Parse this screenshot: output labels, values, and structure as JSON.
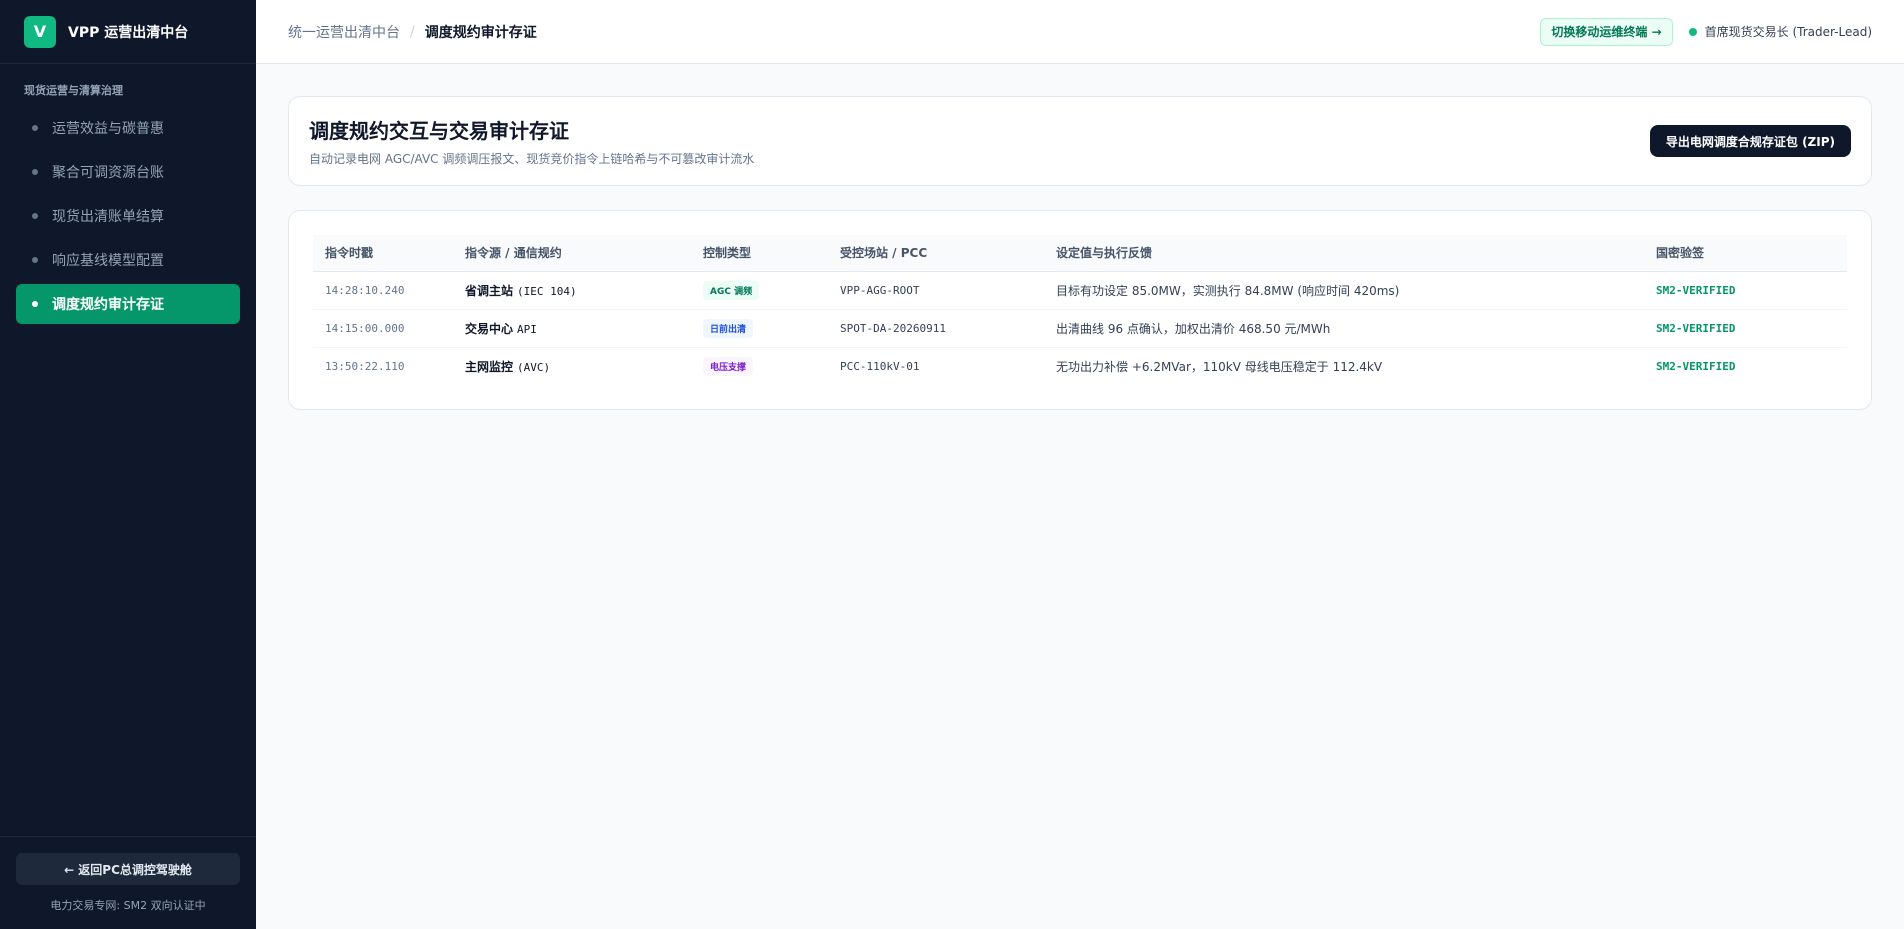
{
  "brand": {
    "logo_letter": "V",
    "name": "VPP 运营出清中台"
  },
  "sidebar": {
    "section_title": "现货运营与清算治理",
    "items": [
      {
        "label": "运营效益与碳普惠",
        "active": false
      },
      {
        "label": "聚合可调资源台账",
        "active": false
      },
      {
        "label": "现货出清账单结算",
        "active": false
      },
      {
        "label": "响应基线模型配置",
        "active": false
      },
      {
        "label": "调度规约审计存证",
        "active": true
      }
    ],
    "back_button": "← 返回PC总调控驾驶舱",
    "footer_note": "电力交易专网: SM2 双向认证中"
  },
  "topbar": {
    "breadcrumb_parent": "统一运营出清中台",
    "breadcrumb_separator": "/",
    "breadcrumb_current": "调度规约审计存证",
    "switch_button": "切换移动运维终端 →",
    "user_label": "首席现货交易长 (Trader-Lead)"
  },
  "header": {
    "title": "调度规约交互与交易审计存证",
    "subtitle": "自动记录电网 AGC/AVC 调频调压报文、现货竞价指令上链哈希与不可篡改审计流水",
    "export_button": "导出电网调度合规存证包 (ZIP)"
  },
  "table": {
    "columns": [
      "指令时戳",
      "指令源 / 通信规约",
      "控制类型",
      "受控场站 / PCC",
      "设定值与执行反馈",
      "国密验签"
    ],
    "rows": [
      {
        "time": "14:28:10.240",
        "source": "省调主站",
        "protocol": "(IEC 104)",
        "control_type": "AGC 调频",
        "badge_bg": "#ecfdf5",
        "badge_color": "#047857",
        "station": "VPP-AGG-ROOT",
        "feedback": "目标有功设定 85.0MW，实测执行 84.8MW (响应时间 420ms)",
        "verify": "SM2-VERIFIED"
      },
      {
        "time": "14:15:00.000",
        "source": "交易中心",
        "protocol": "API",
        "control_type": "日前出清",
        "badge_bg": "#eff6ff",
        "badge_color": "#1d4ed8",
        "station": "SPOT-DA-20260911",
        "feedback": "出清曲线 96 点确认，加权出清价 468.50 元/MWh",
        "verify": "SM2-VERIFIED"
      },
      {
        "time": "13:50:22.110",
        "source": "主网监控",
        "protocol": "(AVC)",
        "control_type": "电压支撑",
        "badge_bg": "#faf5ff",
        "badge_color": "#7e22ce",
        "station": "PCC-110kV-01",
        "feedback": "无功出力补偿 +6.2MVar，110kV 母线电压稳定于 112.4kV",
        "verify": "SM2-VERIFIED"
      }
    ]
  }
}
